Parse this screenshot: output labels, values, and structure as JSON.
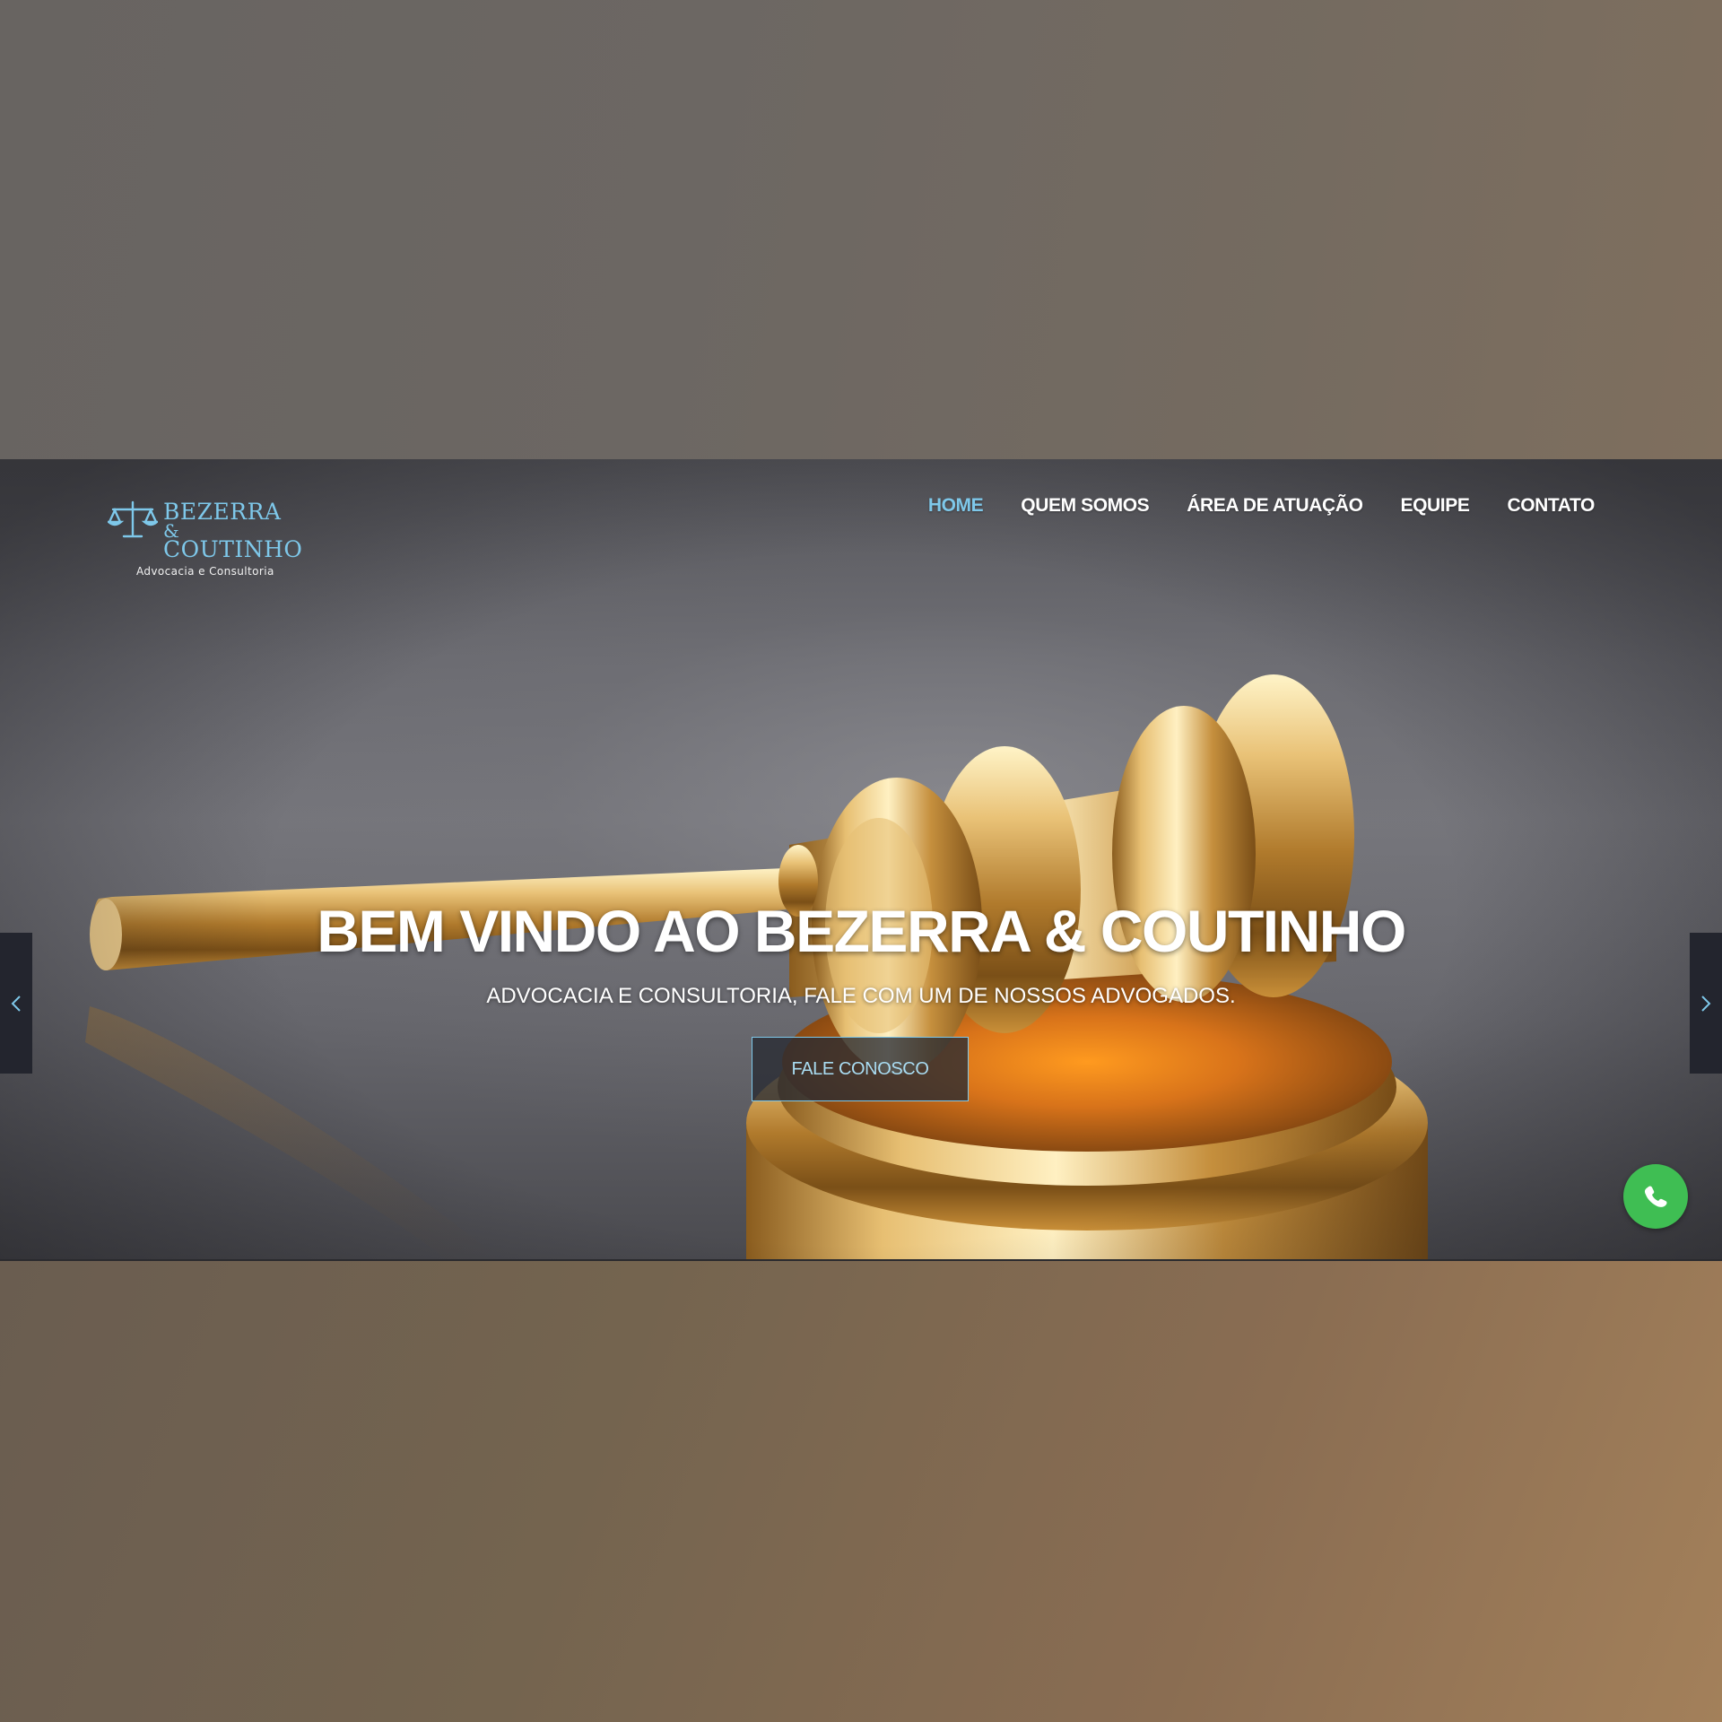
{
  "brand": {
    "name_line1": "BEZERRA",
    "name_line2": "&",
    "name_line3": "COUTINHO",
    "tagline": "Advocacia e Consultoria",
    "logo_icon": "scales-of-justice-icon",
    "accent_color": "#7ec8ea"
  },
  "nav": {
    "items": [
      {
        "label": "HOME",
        "active": true
      },
      {
        "label": "QUEM SOMOS",
        "active": false
      },
      {
        "label": "ÁREA DE ATUAÇÃO",
        "active": false
      },
      {
        "label": "EQUIPE",
        "active": false
      },
      {
        "label": "CONTATO",
        "active": false
      }
    ]
  },
  "hero": {
    "title": "BEM VINDO AO BEZERRA & COUTINHO",
    "subtitle": "ADVOCACIA E CONSULTORIA, FALE COM UM DE NOSSOS ADVOGADOS.",
    "cta_label": "FALE CONOSCO",
    "background": "golden-gavel-image"
  },
  "slider": {
    "prev_icon": "chevron-left-icon",
    "next_icon": "chevron-right-icon"
  },
  "whatsapp": {
    "icon": "whatsapp-phone-icon",
    "color": "#3fbe53"
  }
}
